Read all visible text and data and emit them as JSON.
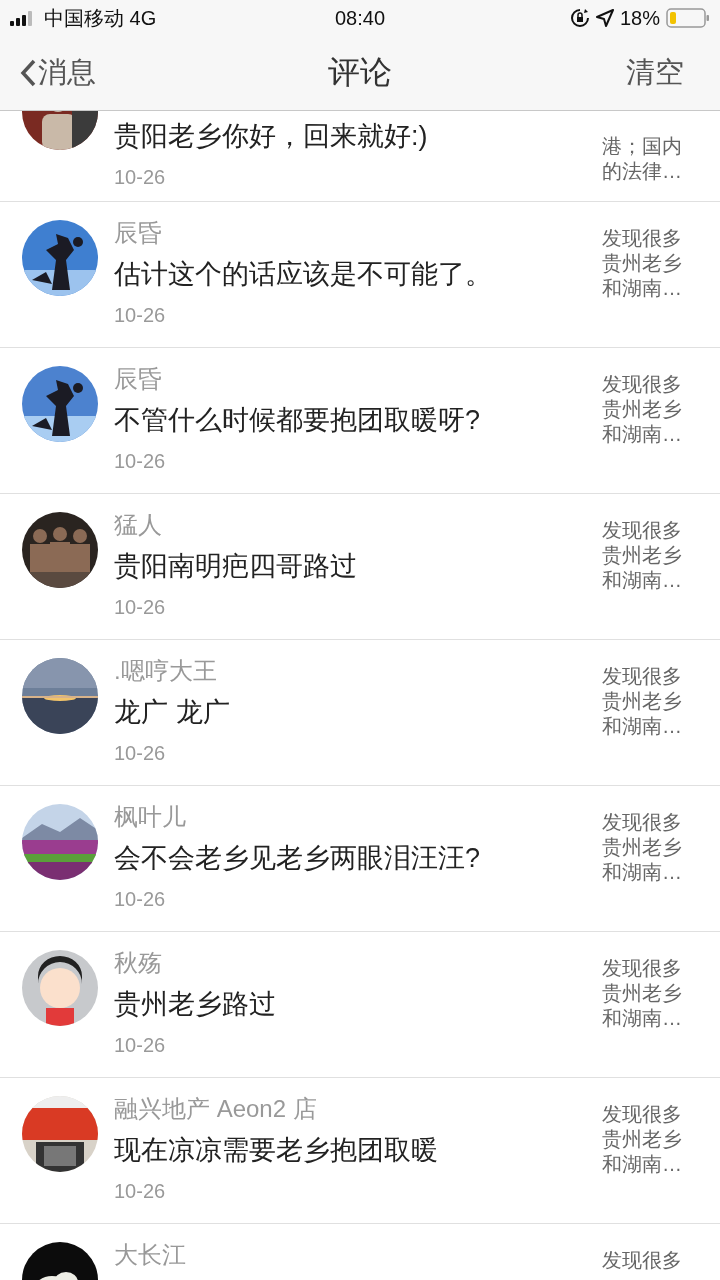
{
  "status_bar": {
    "carrier": "中国移动 4G",
    "time": "08:40",
    "battery": "18%"
  },
  "nav": {
    "back": "消息",
    "title": "评论",
    "action": "清空"
  },
  "comments": [
    {
      "kind": "partial",
      "comment": "贵阳老乡你好，回来就好:)",
      "date": "10-26",
      "preview": [
        "港；国内",
        "的法律…"
      ]
    },
    {
      "kind": "full",
      "name": "辰昏",
      "comment": "估计这个的话应该是不可能了。",
      "date": "10-26",
      "preview": [
        "发现很多",
        "贵州老乡",
        "和湖南…"
      ]
    },
    {
      "kind": "full",
      "name": "辰昏",
      "comment": "不管什么时候都要抱团取暖呀?",
      "date": "10-26",
      "preview": [
        "发现很多",
        "贵州老乡",
        "和湖南…"
      ]
    },
    {
      "kind": "full",
      "name": "猛人",
      "comment": "贵阳南明疤四哥路过",
      "date": "10-26",
      "preview": [
        "发现很多",
        "贵州老乡",
        "和湖南…"
      ]
    },
    {
      "kind": "full",
      "name": ".嗯哼大王",
      "comment": "龙广 龙广",
      "date": "10-26",
      "preview": [
        "发现很多",
        "贵州老乡",
        "和湖南…"
      ]
    },
    {
      "kind": "full",
      "name": "枫叶儿",
      "comment": "会不会老乡见老乡两眼泪汪汪?",
      "date": "10-26",
      "preview": [
        "发现很多",
        "贵州老乡",
        "和湖南…"
      ]
    },
    {
      "kind": "full",
      "name": "秋殇",
      "comment": "贵州老乡路过",
      "date": "10-26",
      "preview": [
        "发现很多",
        "贵州老乡",
        "和湖南…"
      ]
    },
    {
      "kind": "full",
      "name": "融兴地产 Aeon2 店",
      "comment": "现在凉凉需要老乡抱团取暖",
      "date": "10-26",
      "preview": [
        "发现很多",
        "贵州老乡",
        "和湖南…"
      ]
    },
    {
      "kind": "full",
      "name": "大长江",
      "preview": [
        "发现很多"
      ]
    }
  ]
}
